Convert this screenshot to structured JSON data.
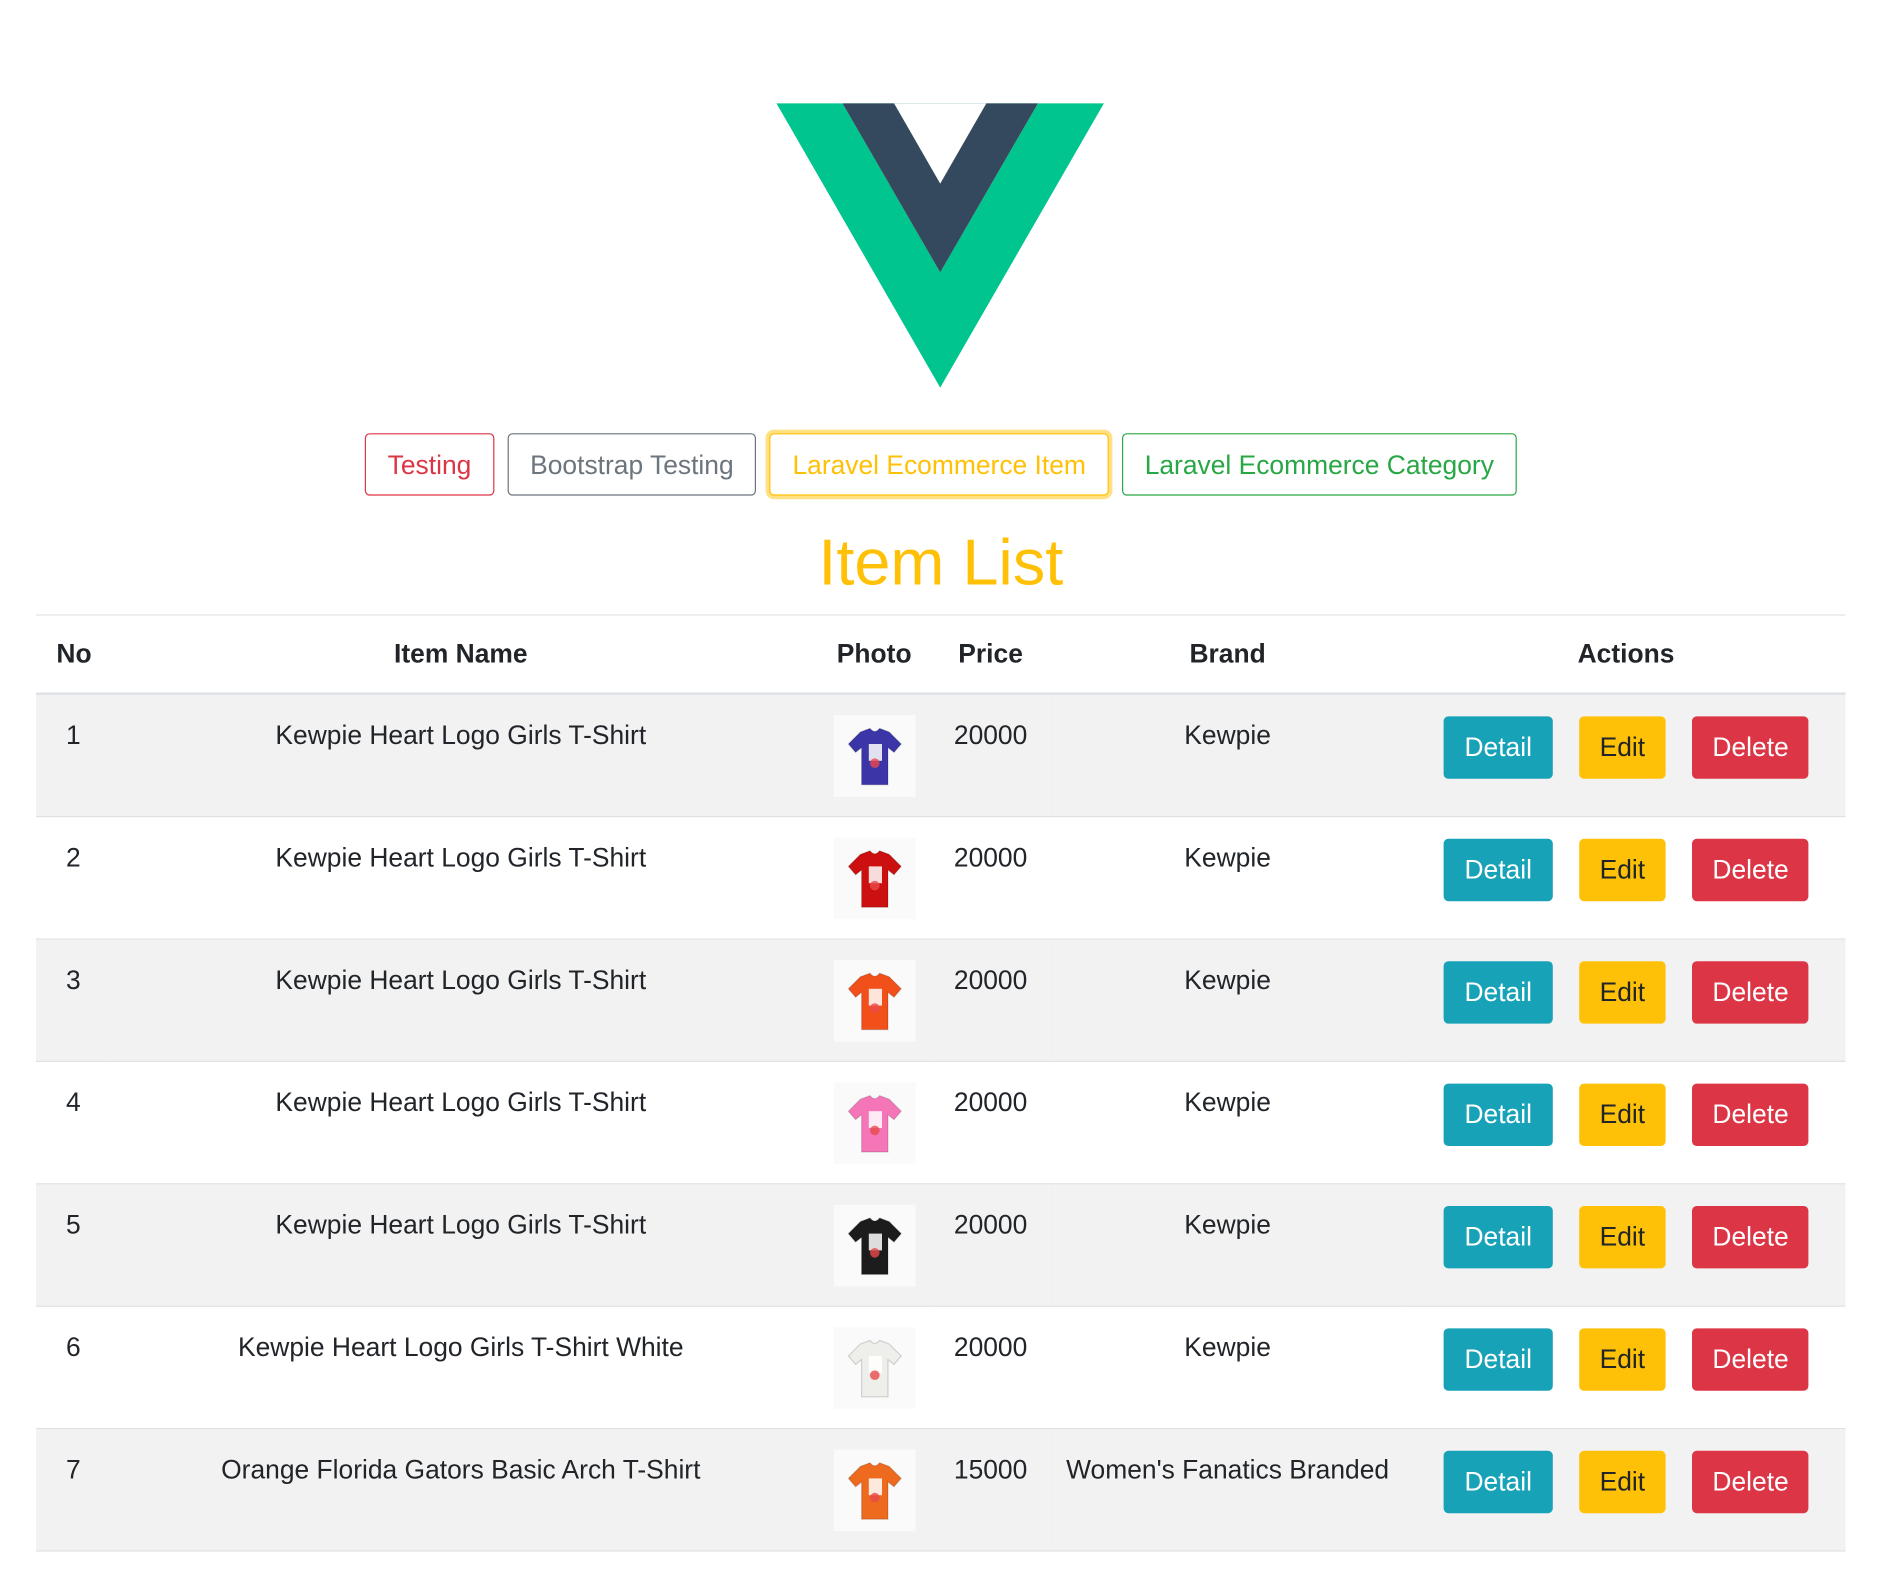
{
  "brand": {
    "logo_icon": "vue-logo-icon",
    "logo_colors": {
      "outer": "#41b883",
      "inner": "#35495e"
    }
  },
  "nav": {
    "buttons": [
      {
        "label": "Testing",
        "color": "#dc3545"
      },
      {
        "label": "Bootstrap Testing",
        "color": "#6c757d"
      },
      {
        "label": "Laravel Ecommerce Item",
        "color": "#ffc107",
        "active": true
      },
      {
        "label": "Laravel Ecommerce Category",
        "color": "#28a745"
      }
    ]
  },
  "page": {
    "title": "Item List"
  },
  "table": {
    "headers": {
      "no": "No",
      "item_name": "Item Name",
      "photo": "Photo",
      "price": "Price",
      "brand": "Brand",
      "actions": "Actions"
    },
    "action_labels": {
      "detail": "Detail",
      "edit": "Edit",
      "delete": "Delete"
    },
    "rows": [
      {
        "no": "1",
        "item_name": "Kewpie Heart Logo Girls T-Shirt",
        "photo": "blue-tshirt-photo",
        "photo_color": "#3b35a8",
        "price": "20000",
        "brand": "Kewpie"
      },
      {
        "no": "2",
        "item_name": "Kewpie Heart Logo Girls T-Shirt",
        "photo": "red-tshirt-photo",
        "photo_color": "#cc1010",
        "price": "20000",
        "brand": "Kewpie"
      },
      {
        "no": "3",
        "item_name": "Kewpie Heart Logo Girls T-Shirt",
        "photo": "orange-tshirt-photo",
        "photo_color": "#f2501a",
        "price": "20000",
        "brand": "Kewpie"
      },
      {
        "no": "4",
        "item_name": "Kewpie Heart Logo Girls T-Shirt",
        "photo": "pink-tshirt-photo",
        "photo_color": "#f576b8",
        "price": "20000",
        "brand": "Kewpie"
      },
      {
        "no": "5",
        "item_name": "Kewpie Heart Logo Girls T-Shirt",
        "photo": "black-tshirt-photo",
        "photo_color": "#1c1c1c",
        "price": "20000",
        "brand": "Kewpie"
      },
      {
        "no": "6",
        "item_name": "Kewpie Heart Logo Girls T-Shirt White",
        "photo": "white-tshirt-photo",
        "photo_color": "#eeeeea",
        "price": "20000",
        "brand": "Kewpie"
      },
      {
        "no": "7",
        "item_name": "Orange Florida Gators Basic Arch T-Shirt",
        "photo": "orange-gators-tshirt-photo",
        "photo_color": "#ee6a1f",
        "price": "15000",
        "brand": "Women's Fanatics Branded"
      }
    ]
  }
}
